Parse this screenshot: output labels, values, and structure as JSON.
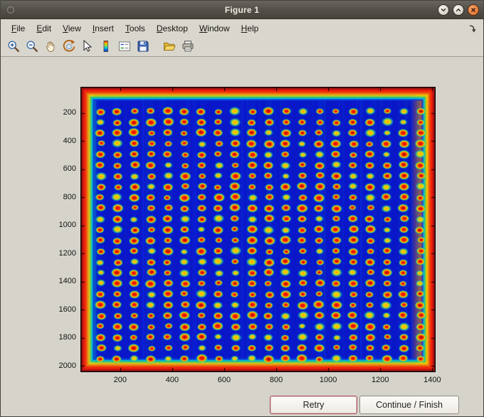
{
  "window": {
    "title": "Figure 1",
    "controls": [
      "minimize",
      "maximize",
      "close"
    ]
  },
  "menubar": {
    "items": [
      "File",
      "Edit",
      "View",
      "Insert",
      "Tools",
      "Desktop",
      "Window",
      "Help"
    ]
  },
  "toolbar": {
    "buttons": [
      "zoom-in",
      "zoom-out",
      "pan",
      "rotate-3d",
      "data-cursor",
      "insert-colorbar",
      "insert-legend",
      "save-figure",
      "separator",
      "open-file",
      "print-figure"
    ]
  },
  "dialog_buttons": {
    "retry": "Retry",
    "continue_finish": "Continue / Finish"
  },
  "chart_data": {
    "type": "heatmap",
    "title": "",
    "description": "Jet-colormap intensity image of a spotted assay plate: deep blue field, 20x24 grid of red-orange spots with yellow-green halos, hot red-orange band around the plate edges",
    "x_range": [
      50,
      1410
    ],
    "y_range": [
      20,
      2040
    ],
    "x_ticks": [
      200,
      400,
      600,
      800,
      1000,
      1200,
      1400
    ],
    "y_ticks": [
      200,
      400,
      600,
      800,
      1000,
      1200,
      1400,
      1600,
      1800,
      2000
    ],
    "grid": false,
    "legend": false,
    "spot_grid": {
      "cols": 20,
      "rows": 24,
      "x0": 125,
      "dx": 64.7,
      "y0": 190,
      "dy": 76.5
    },
    "colors": {
      "field_blue": "#0a17c9",
      "spot_core_red": "#c81000",
      "spot_mid_orange": "#ff7a00",
      "spot_halo_yellow": "#ffd400",
      "spot_ring_green": "#3cd68c",
      "edge_hot_red": "#fa2000",
      "edge_cyan": "#00b4e4"
    }
  }
}
